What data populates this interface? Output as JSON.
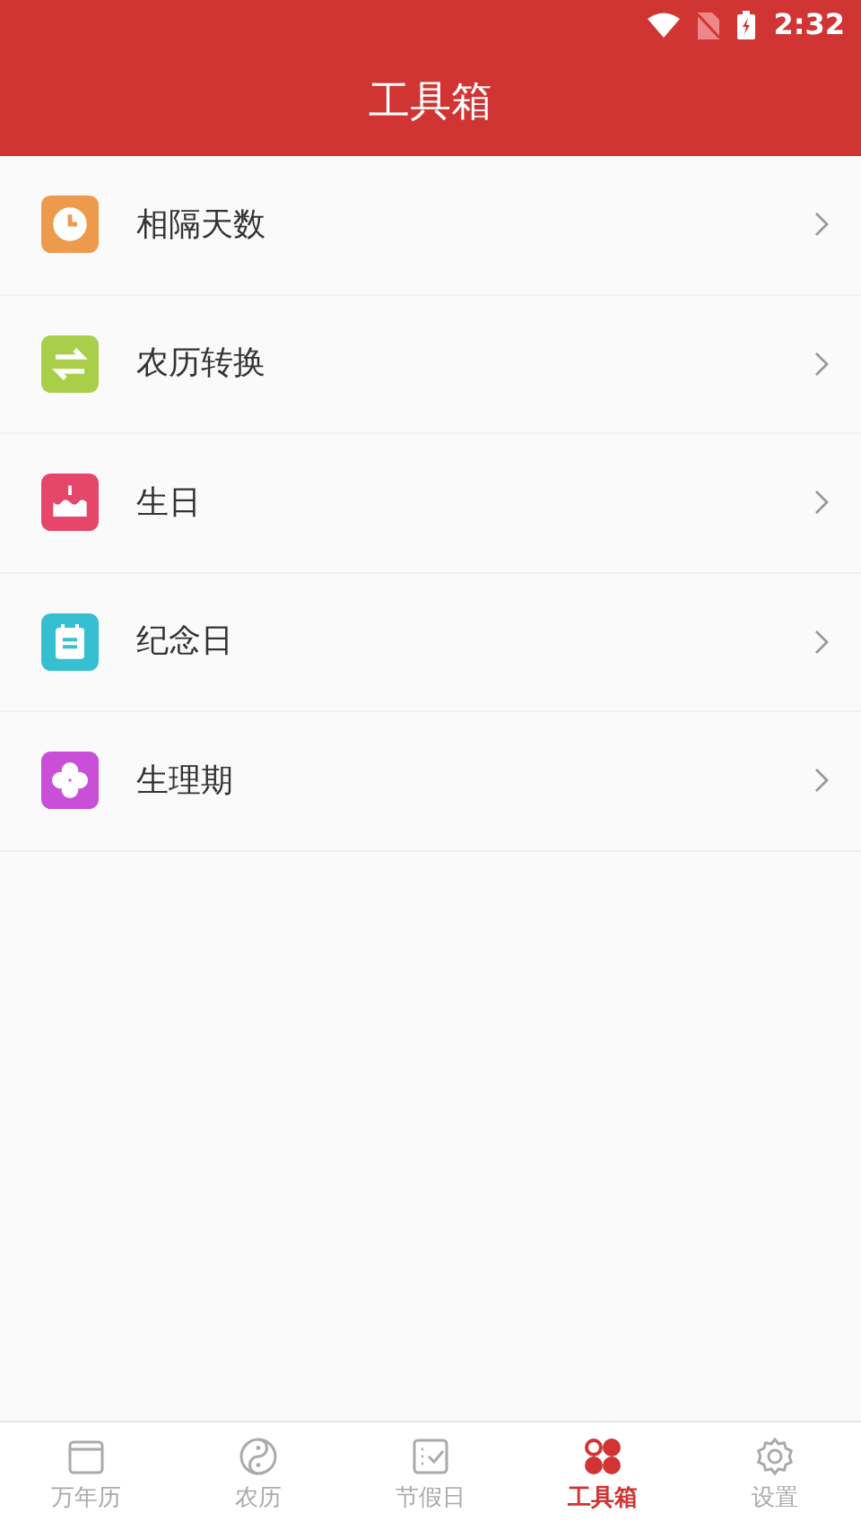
{
  "status_bar": {
    "time": "2:32"
  },
  "header": {
    "title": "工具箱"
  },
  "tools": [
    {
      "kind": "clock",
      "label": "相隔天数",
      "color": "#ee9a4c"
    },
    {
      "kind": "swap",
      "label": "农历转换",
      "color": "#a9cf4a"
    },
    {
      "kind": "cake",
      "label": "生日",
      "color": "#e5466a"
    },
    {
      "kind": "note",
      "label": "纪念日",
      "color": "#35bfd0"
    },
    {
      "kind": "flower",
      "label": "生理期",
      "color": "#c94fd8"
    }
  ],
  "tabs": [
    {
      "kind": "calendar",
      "label": "万年历",
      "selected": false
    },
    {
      "kind": "yinyang",
      "label": "农历",
      "selected": false
    },
    {
      "kind": "check",
      "label": "节假日",
      "selected": false
    },
    {
      "kind": "grid",
      "label": "工具箱",
      "selected": true
    },
    {
      "kind": "gear",
      "label": "设置",
      "selected": false
    }
  ]
}
